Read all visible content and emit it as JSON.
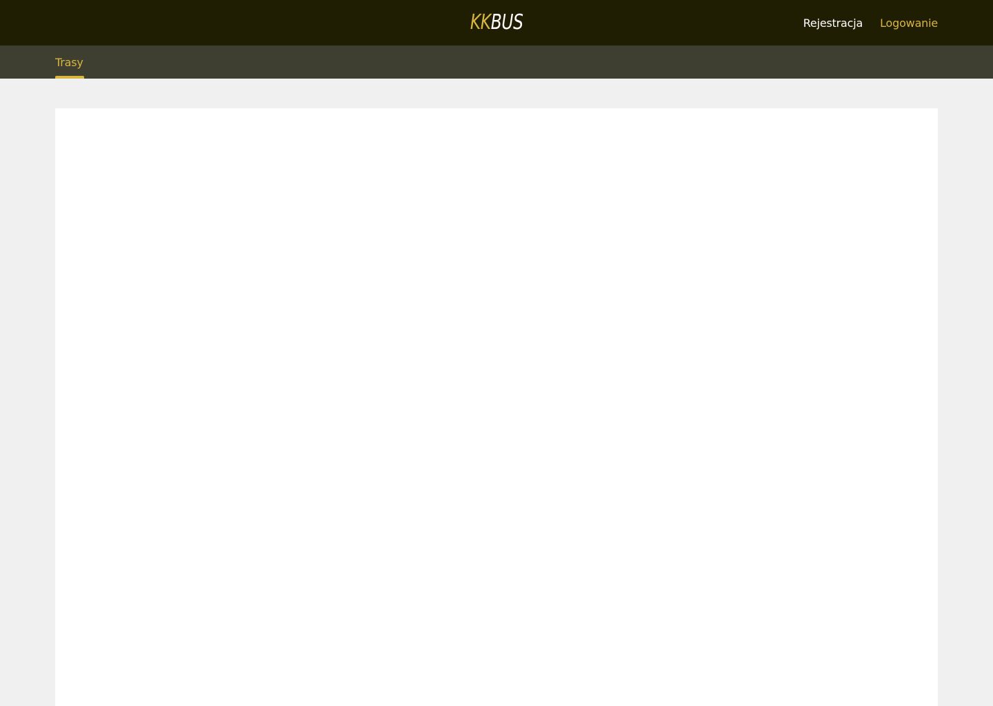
{
  "header": {
    "logo": {
      "part1": "KK",
      "part2": "BUS"
    },
    "links": {
      "register": "Rejestracja",
      "login": "Logowanie"
    }
  },
  "subnav": {
    "tabs": [
      {
        "label": "Trasy",
        "active": true
      }
    ]
  },
  "colors": {
    "topbar_bg": "#201e02",
    "subnav_bg": "#3e3f31",
    "accent": "#d8b640",
    "page_bg": "#f0f0f0",
    "panel_bg": "#ffffff"
  }
}
